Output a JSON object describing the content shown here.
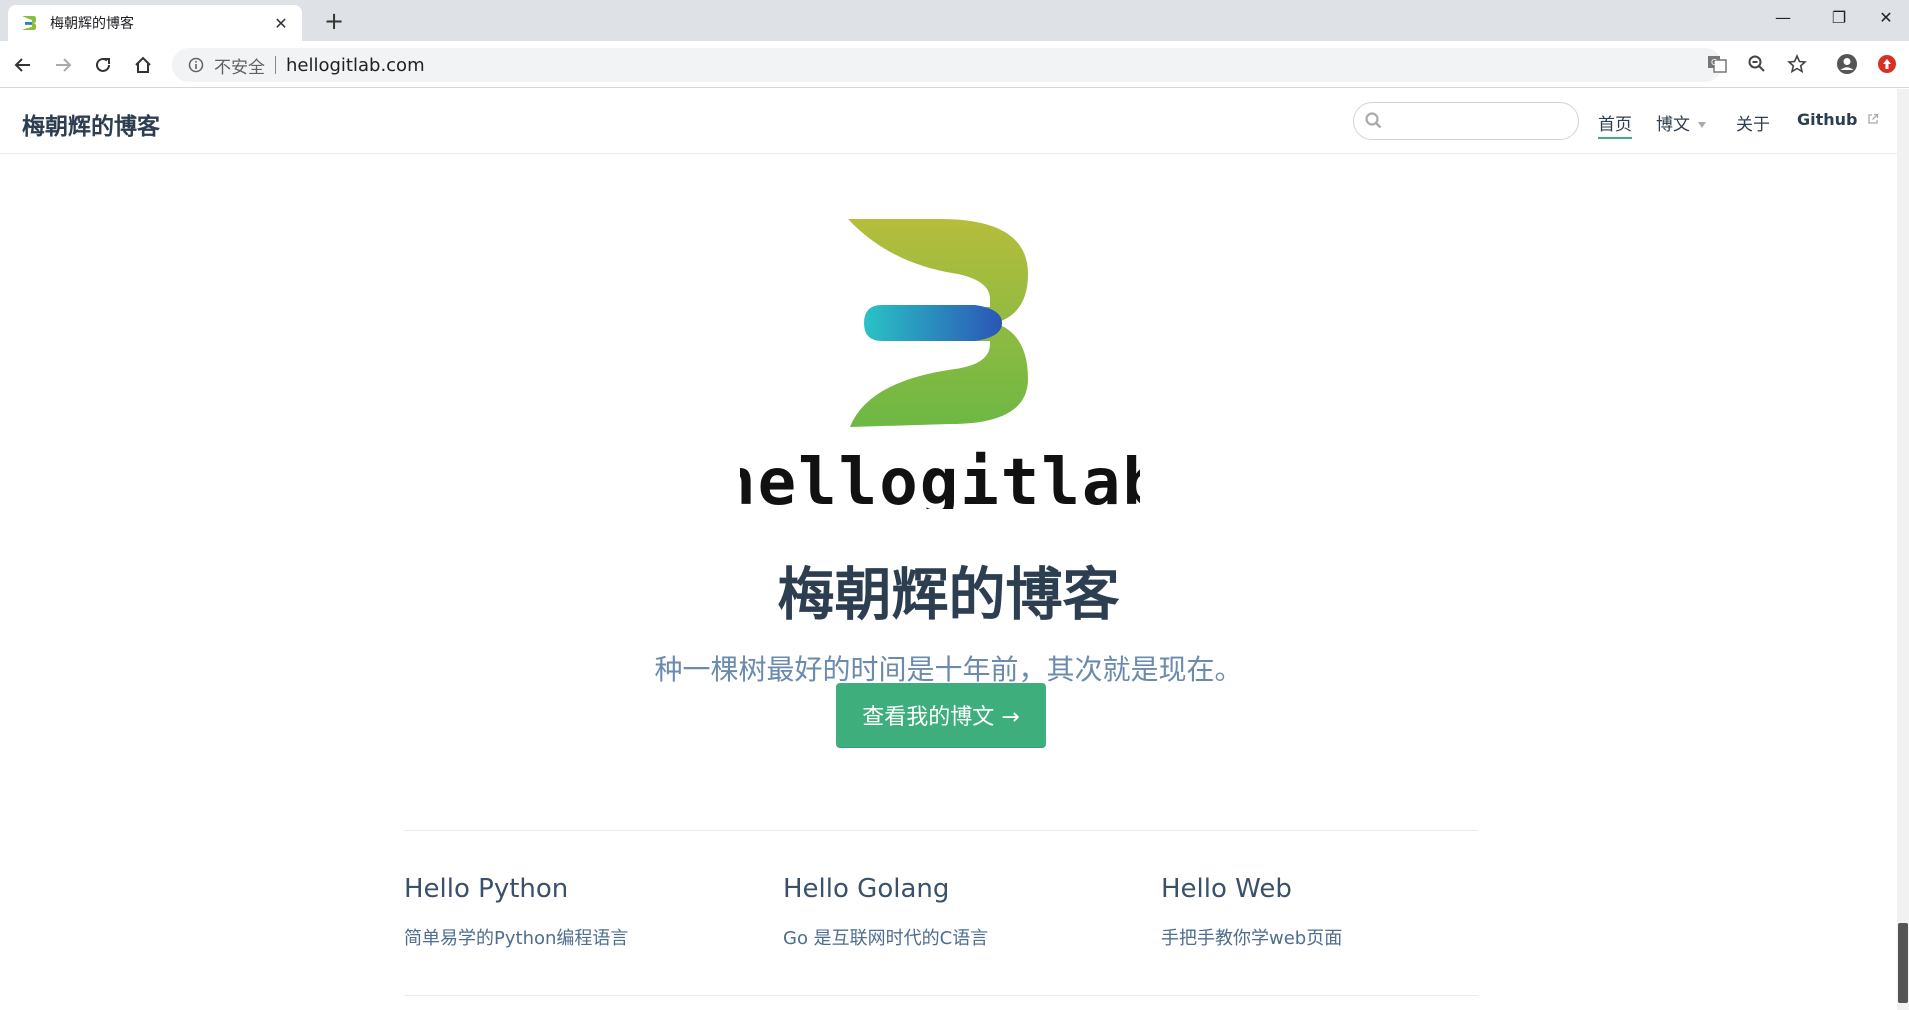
{
  "browser": {
    "tab_title": "梅朝辉的博客",
    "security_label": "不安全",
    "url": "hellogitlab.com"
  },
  "site": {
    "title": "梅朝辉的博客",
    "search_placeholder": "",
    "nav": [
      {
        "label": "首页",
        "active": true
      },
      {
        "label": "博文",
        "dropdown": true
      },
      {
        "label": "关于"
      },
      {
        "label": "Github",
        "external": true
      }
    ]
  },
  "hero": {
    "logo_text": "hellogitlab",
    "title": "梅朝辉的博客",
    "description": "种一棵树最好的时间是十年前，其次就是现在。",
    "action_label": "查看我的博文 →"
  },
  "features": [
    {
      "title": "Hello Python",
      "details": "简单易学的Python编程语言"
    },
    {
      "title": "Hello Golang",
      "details": "Go 是互联网时代的C语言"
    },
    {
      "title": "Hello Web",
      "details": "手把手教你学web页面"
    }
  ],
  "colors": {
    "accent": "#3eaf7c",
    "text": "#2c3e50",
    "muted": "#6a8bad"
  }
}
